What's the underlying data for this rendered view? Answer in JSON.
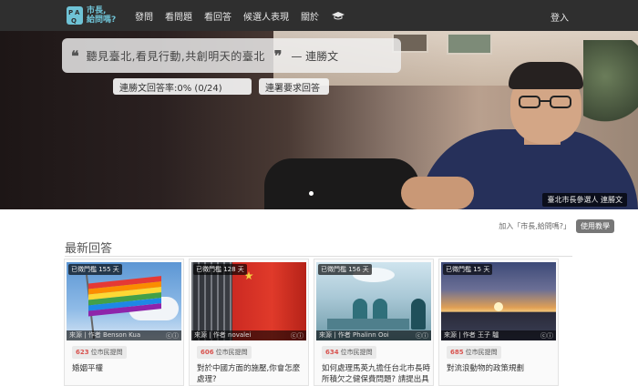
{
  "nav": {
    "logo": {
      "mark": "PAQ",
      "line1": "市長,",
      "line2": "給問嗎?"
    },
    "items": [
      "發問",
      "看問題",
      "看回答",
      "候選人表現",
      "關於"
    ],
    "hat_icon": "graduation-cap-icon",
    "login": "登入"
  },
  "hero": {
    "quote_open": "❝",
    "quote": "聽見臺北,看見行動,共創明天的臺北",
    "quote_close": "❞",
    "author": "— 連勝文",
    "answer_rate": "連勝文回答率:0% (0/24)",
    "sign_button": "連署要求回答",
    "caption": "臺北市長參選人 連勝文"
  },
  "join": {
    "text": "加入「市長,給問嗎?」",
    "button": "使用教學"
  },
  "section": {
    "title": "最新回答"
  },
  "cards": [
    {
      "days": "已徵門檻 155 天",
      "source": "來源 | 作者 Benson Kua",
      "voters": "623",
      "voters_label": "位市民提問",
      "question": "婚姻平權",
      "scene": "rainbow-flag"
    },
    {
      "days": "已徵門檻 128 天",
      "source": "來源 | 作者 novalei",
      "voters": "606",
      "voters_label": "位市民提問",
      "question": "對於中國方面的施壓,你會怎麼處理?",
      "scene": "china-flag"
    },
    {
      "days": "已徵門檻 156 天",
      "source": "來源 | 作者 Phalinn Ooi",
      "voters": "634",
      "voters_label": "位市民提問",
      "question": "如何處理馬英九擔任台北市長時所積欠之健保費問題? 請提出具",
      "scene": "operating-room"
    },
    {
      "days": "已徵門檻 15 天",
      "source": "來源 | 作者 王子 驢",
      "voters": "685",
      "voters_label": "位市民提問",
      "question": "對流浪動物的政策規劃",
      "scene": "sunset"
    }
  ],
  "colors": {
    "navbar": "#2f2f2f",
    "logo_accent": "#6fc3d6",
    "voters_number": "#d9534f"
  }
}
